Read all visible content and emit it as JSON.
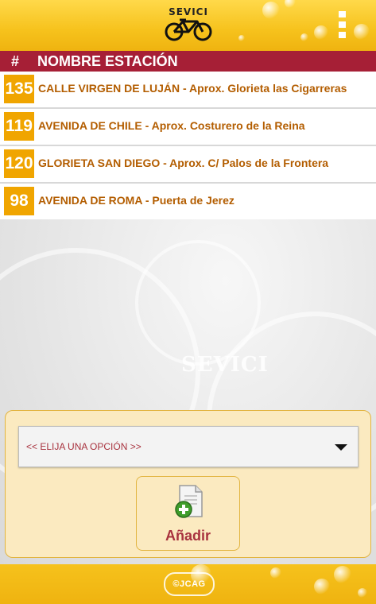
{
  "header": {
    "logo_text": "SEVICI",
    "menu_icon": "overflow-menu-icon"
  },
  "table": {
    "col_number": "#",
    "col_name": "NOMBRE ESTACIÓN",
    "rows": [
      {
        "number": "135",
        "name": "CALLE VIRGEN DE LUJÁN - Aprox. Glorieta las Cigarreras"
      },
      {
        "number": "119",
        "name": "AVENIDA DE CHILE - Aprox. Costurero de la Reina"
      },
      {
        "number": "120",
        "name": "GLORIETA SAN DIEGO - Aprox. C/ Palos de la Frontera"
      },
      {
        "number": "98",
        "name": "AVENIDA DE ROMA - Puerta de Jerez"
      }
    ]
  },
  "background": {
    "watermark_text": "SEVICI"
  },
  "form": {
    "select_value": "<< ELIJA UNA OPCIÓN >>",
    "add_label": "Añadir",
    "add_icon": "add-document-icon"
  },
  "footer": {
    "copyright": "©JCAG"
  },
  "colors": {
    "header_yellow": "#f6c21c",
    "table_header_red": "#a61f36",
    "number_badge_orange": "#f0a500",
    "row_text_brown": "#b35d00",
    "accent_red": "#a8323e",
    "panel_bg": "#fbeac0"
  }
}
